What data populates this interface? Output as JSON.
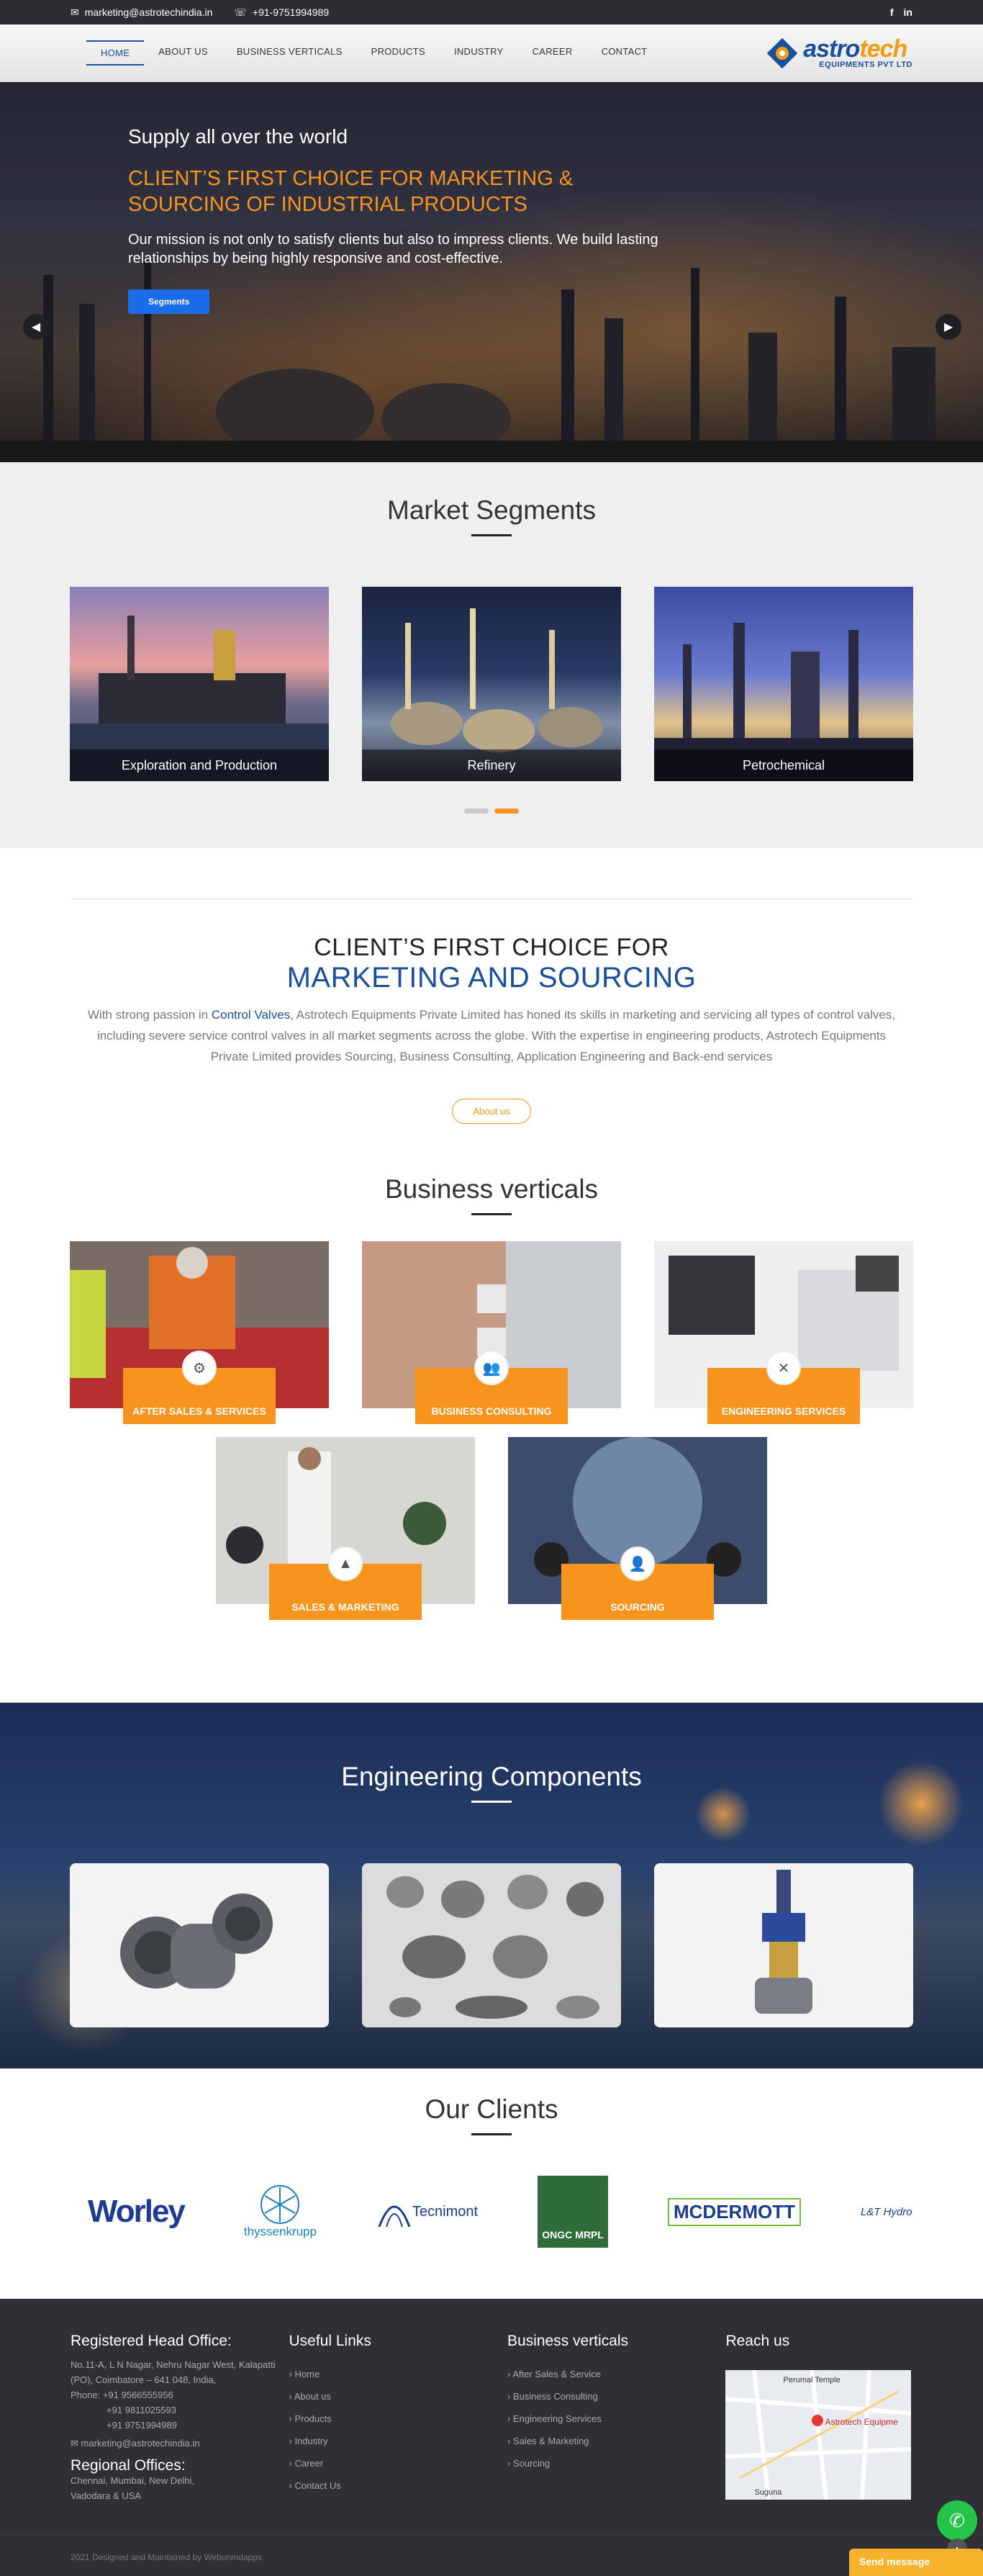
{
  "topbar": {
    "email": "marketing@astrotechindia.in",
    "phone": "+91-9751994989",
    "facebook": "f",
    "linkedin": "in"
  },
  "nav": {
    "items": [
      "HOME",
      "ABOUT US",
      "BUSINESS VERTICALS",
      "PRODUCTS",
      "INDUSTRY",
      "CAREER",
      "CONTACT"
    ]
  },
  "logo": {
    "brand_a": "astro",
    "brand_b": "tech",
    "sub": "EQUIPMENTS PVT LTD"
  },
  "hero": {
    "kicker": "Supply all over the world",
    "headline": "CLIENT’S FIRST CHOICE FOR MARKETING & SOURCING OF INDUSTRIAL PRODUCTS",
    "body": "Our mission is not only to satisfy clients but also to impress clients. We build lasting relationships by being highly responsive and cost-effective.",
    "button": "Segments"
  },
  "segments": {
    "title": "Market Segments",
    "cards": [
      "Exploration and Production",
      "Refinery",
      "Petrochemical"
    ]
  },
  "about": {
    "line1": "CLIENT’S FIRST CHOICE FOR",
    "line2": "MARKETING AND SOURCING",
    "p_before": "With strong passion in ",
    "p_link": "Control Valves",
    "p_after": ", Astrotech Equipments Private Limited has honed its skills in marketing and servicing all types of control valves, including severe service control valves in all market segments across the globe. With the expertise in engineering products, Astrotech Equipments Private Limited provides Sourcing, Business Consulting, Application Engineering and Back-end services",
    "button": "About us"
  },
  "verticals": {
    "title": "Business verticals",
    "items": [
      "AFTER SALES & SERVICES",
      "BUSINESS CONSULTING",
      "ENGINEERING SERVICES",
      "SALES & MARKETING",
      "SOURCING"
    ]
  },
  "components": {
    "title": "Engineering Components"
  },
  "clients": {
    "title": "Our Clients",
    "logos": [
      "Worley",
      "thyssenkrupp",
      "Tecnimont",
      "ONGC MRPL",
      "MCDERMOTT",
      "L&T Hydro Engineering"
    ]
  },
  "footer": {
    "office_title": "Registered Head Office:",
    "address": "No.11-A, L N Nagar, Nehru Nagar West, Kalapatti (PO), Coimbatore – 641 048, India,",
    "phones_label": "Phone:",
    "phones": [
      "+91 9566555956",
      "+91 9811025593",
      "+91 9751994989"
    ],
    "email": "marketing@astrotechindia.in",
    "regional_title": "Regional Offices:",
    "regional": "Chennai, Mumbai, New Delhi, Vadodara & USA",
    "links_title": "Useful Links",
    "links": [
      "Home",
      "About us",
      "Products",
      "Industry",
      "Career",
      "Contact Us"
    ],
    "verticals_title": "Business verticals",
    "verticals": [
      "After Sales & Service",
      "Business Consulting",
      "Engineering Services",
      "Sales & Marketing",
      "Sourcing"
    ],
    "reach_title": "Reach us",
    "map_label_a": "Perumal Temple",
    "map_label_b": "Astrotech Equipme",
    "map_label_c": "Suguna",
    "copyright": "2021 Designed and Maintained by Webonmdapps",
    "send_message": "Send message"
  },
  "colors": {
    "accent": "#f7941d",
    "brand_blue": "#1a4fa0",
    "button_blue": "#1a6ce8",
    "footer_bg": "#2f2f36"
  }
}
